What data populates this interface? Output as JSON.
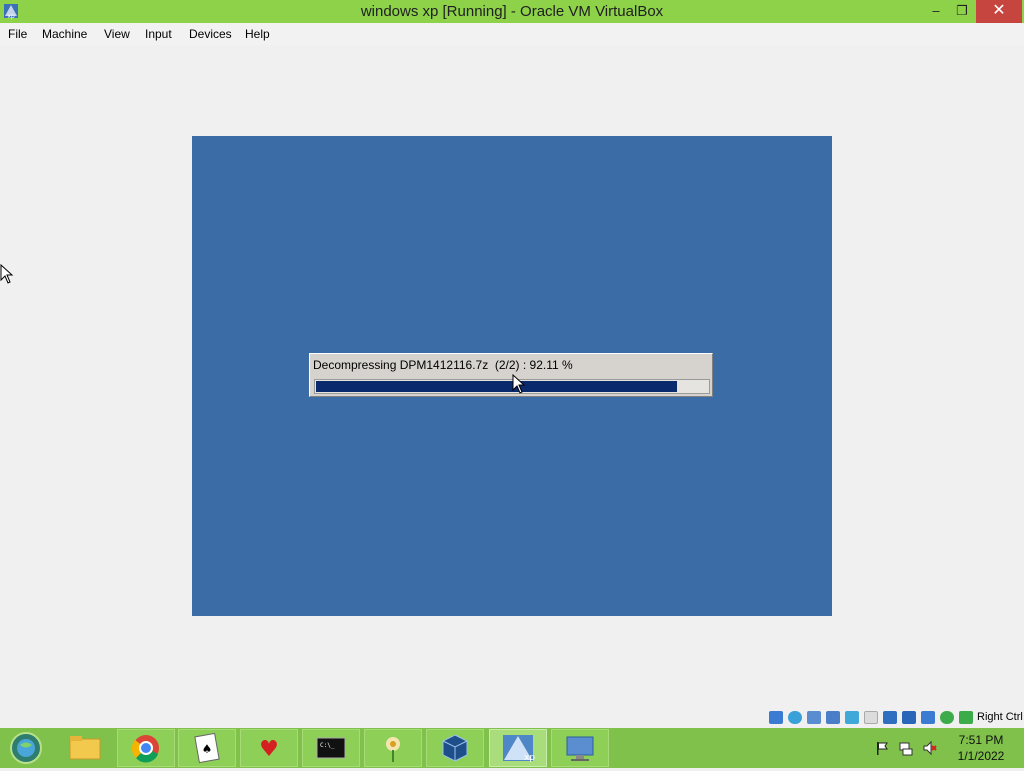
{
  "window": {
    "title": "windows xp [Running] - Oracle VM VirtualBox",
    "minimize_label": "–",
    "restore_label": "❐",
    "close_label": "✕"
  },
  "menubar": {
    "items": [
      "File",
      "Machine",
      "View",
      "Input",
      "Devices",
      "Help"
    ]
  },
  "guest": {
    "background_color": "#3c6ca5",
    "dialog": {
      "message": "Decompressing DPM1412116.7z  (2/2) : 92.11 %",
      "progress_fraction": 0.9211,
      "bar_color": "#0a2a6e"
    }
  },
  "statusbar": {
    "icons": [
      "hard-disk-icon",
      "optical-drive-icon",
      "audio-icon",
      "network-icon",
      "usb-icon",
      "shared-folders-icon",
      "display-icon",
      "video-capture-icon",
      "virtualization-icon",
      "mouse-integration-icon",
      "keyboard-capture-icon"
    ],
    "host_key": "Right Ctrl"
  },
  "taskbar": {
    "buttons": [
      "start-orb-icon",
      "file-explorer-icon",
      "chrome-icon",
      "solitaire-icon",
      "hearts-icon",
      "command-prompt-icon",
      "flower-game-icon",
      "virtualbox-icon",
      "windows-xp-vm-icon",
      "remote-desktop-icon"
    ],
    "tray": [
      "action-center-flag-icon",
      "network-tray-icon",
      "volume-muted-icon"
    ],
    "clock_time": "7:51 PM",
    "clock_date": "1/1/2022",
    "accent_color": "#7fc14a"
  }
}
